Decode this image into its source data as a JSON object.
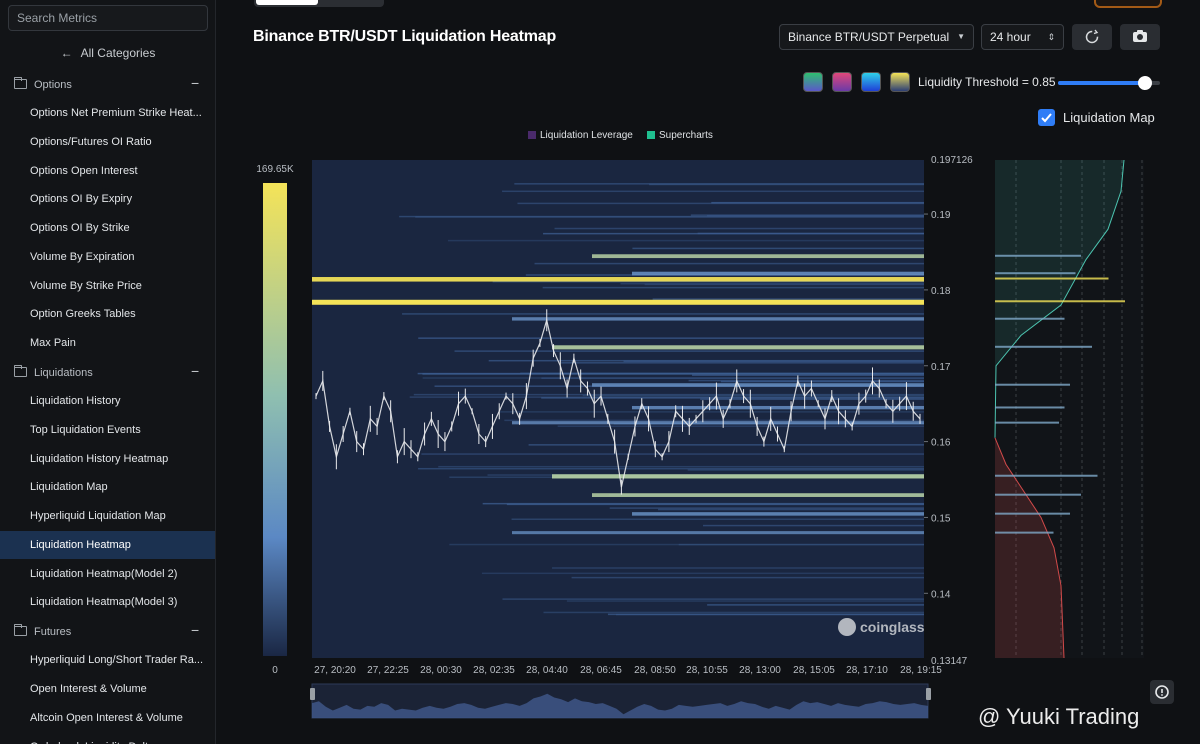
{
  "sidebar": {
    "search_placeholder": "Search Metrics",
    "all_categories": "All Categories",
    "groups": [
      {
        "label": "Options"
      },
      {
        "label": "Liquidations"
      },
      {
        "label": "Futures"
      }
    ],
    "items": [
      "Options Net Premium Strike Heat...",
      "Options/Futures OI Ratio",
      "Options Open Interest",
      "Options OI By Expiry",
      "Options OI By Strike",
      "Volume By Expiration",
      "Volume By Strike Price",
      "Option Greeks Tables",
      "Max Pain",
      "Liquidation History",
      "Top Liquidation Events",
      "Liquidation History Heatmap",
      "Liquidation Map",
      "Hyperliquid Liquidation Map",
      "Liquidation Heatmap",
      "Liquidation Heatmap(Model 2)",
      "Liquidation Heatmap(Model 3)",
      "Hyperliquid Long/Short Trader Ra...",
      "Open Interest & Volume",
      "Altcoin Open Interest & Volume",
      "Orderbook Liquidity Delta"
    ]
  },
  "header": {
    "title": "Binance BTR/USDT Liquidation Heatmap",
    "pair_select": "Binance BTR/USDT Perpetual",
    "range_select": "24 hour",
    "threshold_label": "Liquidity Threshold = 0.85",
    "threshold_value": 0.85,
    "liquidation_map_label": "Liquidation Map",
    "liquidation_map_checked": true
  },
  "icons": {
    "refresh": "refresh-icon",
    "camera": "camera-icon",
    "checkmark": "check-icon",
    "settings": "gear-icon"
  },
  "colors": {
    "accent": "#2f7df6",
    "scale_high": "#f4e358",
    "scale_mid": "#5b88c4",
    "scale_low": "#1a2744",
    "candles": "#e9eaec",
    "short_fill": "#4cc4b0",
    "long_fill": "#d24a4a"
  },
  "watermark": "@ Yuuki Trading",
  "brand": "coinglass",
  "chart_data": {
    "type": "heatmap",
    "title": "Binance BTR/USDT Liquidation Heatmap",
    "legend": [
      {
        "name": "Liquidation Leverage",
        "color": "#4a2a6b"
      },
      {
        "name": "Supercharts",
        "color": "#1fbf8f"
      }
    ],
    "color_scale": {
      "min": "0",
      "max": "169.65K"
    },
    "x_ticks": [
      "27, 20:20",
      "27, 22:25",
      "28, 00:30",
      "28, 02:35",
      "28, 04:40",
      "28, 06:45",
      "28, 08:50",
      "28, 10:55",
      "28, 13:00",
      "28, 15:05",
      "28, 17:10",
      "28, 19:15"
    ],
    "y_axis": {
      "min": 0.13147,
      "max": 0.197126,
      "ticks": [
        "0.19",
        "0.18",
        "0.17",
        "0.16",
        "0.15",
        "0.14"
      ],
      "top_label": "0.197126",
      "bottom_label": "0.13147"
    },
    "price_line": [
      0.166,
      0.168,
      0.162,
      0.158,
      0.161,
      0.164,
      0.16,
      0.159,
      0.163,
      0.162,
      0.166,
      0.164,
      0.158,
      0.16,
      0.159,
      0.158,
      0.161,
      0.163,
      0.161,
      0.16,
      0.162,
      0.165,
      0.166,
      0.164,
      0.161,
      0.16,
      0.162,
      0.164,
      0.166,
      0.165,
      0.163,
      0.166,
      0.171,
      0.173,
      0.176,
      0.172,
      0.17,
      0.167,
      0.171,
      0.168,
      0.167,
      0.165,
      0.166,
      0.163,
      0.16,
      0.154,
      0.158,
      0.162,
      0.165,
      0.163,
      0.159,
      0.158,
      0.16,
      0.164,
      0.163,
      0.162,
      0.163,
      0.164,
      0.165,
      0.166,
      0.163,
      0.165,
      0.168,
      0.166,
      0.165,
      0.162,
      0.16,
      0.163,
      0.161,
      0.159,
      0.164,
      0.168,
      0.166,
      0.167,
      0.165,
      0.163,
      0.166,
      0.164,
      0.163,
      0.162,
      0.165,
      0.166,
      0.168,
      0.167,
      0.165,
      0.164,
      0.165,
      0.166,
      0.164,
      0.163
    ],
    "liquidation_bands": [
      {
        "price": 0.1785,
        "intensity": 1.0
      },
      {
        "price": 0.1815,
        "intensity": 0.85
      },
      {
        "price": 0.1845,
        "intensity": 0.6
      },
      {
        "price": 0.1822,
        "intensity": 0.55
      },
      {
        "price": 0.1762,
        "intensity": 0.45
      },
      {
        "price": 0.1725,
        "intensity": 0.7
      },
      {
        "price": 0.1675,
        "intensity": 0.5
      },
      {
        "price": 0.1645,
        "intensity": 0.45
      },
      {
        "price": 0.1625,
        "intensity": 0.4
      },
      {
        "price": 0.1555,
        "intensity": 0.75
      },
      {
        "price": 0.153,
        "intensity": 0.6
      },
      {
        "price": 0.1505,
        "intensity": 0.5
      },
      {
        "price": 0.148,
        "intensity": 0.35
      }
    ]
  }
}
